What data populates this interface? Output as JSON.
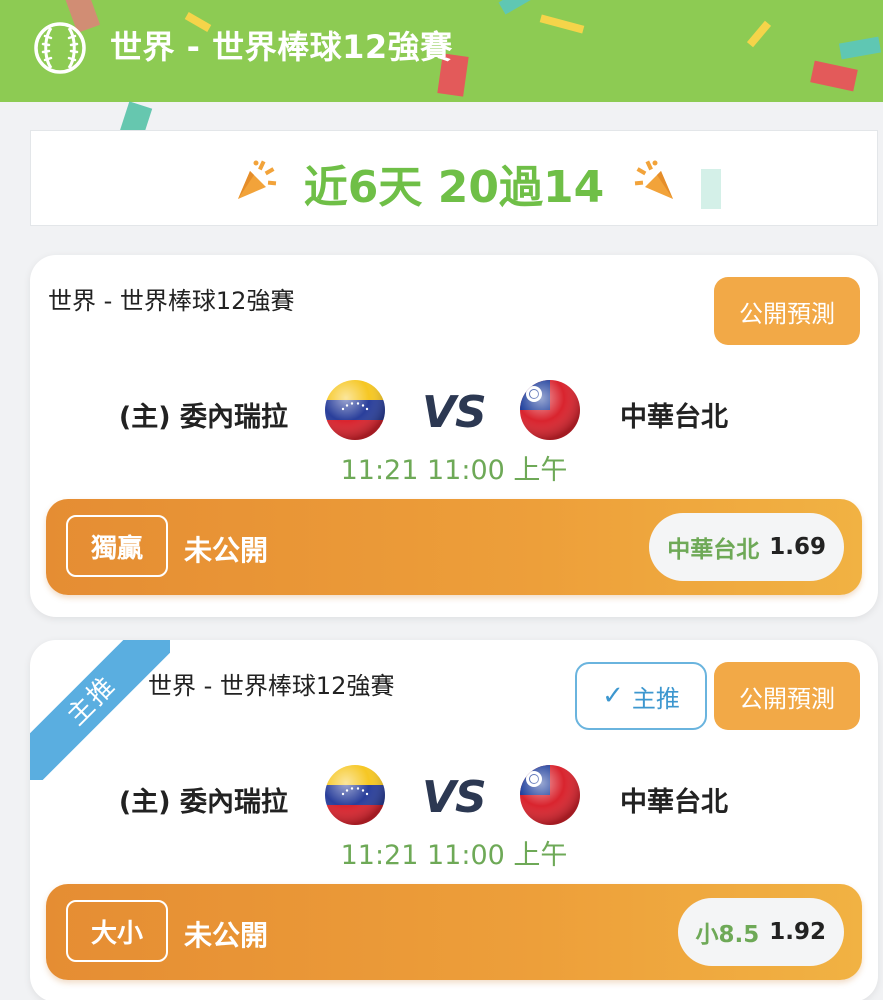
{
  "header": {
    "title": "世界 - 世界棒球12強賽",
    "icon": "baseball-icon",
    "bg_color": "#8dcb53"
  },
  "banner": {
    "stats": "近6天 20過14",
    "icons": [
      "party-popper-icon",
      "party-popper-icon"
    ],
    "text_color": "#6fbf47"
  },
  "matches": [
    {
      "league": "世界 - 世界棒球12強賽",
      "public_label": "公開預測",
      "home_team": "(主) 委內瑞拉",
      "home_flag": "venezuela-flag-icon",
      "vs": "VS",
      "away_team": "中華台北",
      "away_flag": "taiwan-flag-icon",
      "time": "11:21 11:00 上午",
      "bet_type": "獨贏",
      "bet_status": "未公開",
      "pick": "中華台北",
      "odds": "1.69"
    },
    {
      "ribbon": "主推",
      "league": "世界 - 世界棒球12強賽",
      "main_label": "主推",
      "public_label": "公開預測",
      "home_team": "(主) 委內瑞拉",
      "home_flag": "venezuela-flag-icon",
      "vs": "VS",
      "away_team": "中華台北",
      "away_flag": "taiwan-flag-icon",
      "time": "11:21 11:00 上午",
      "bet_type": "大小",
      "bet_status": "未公開",
      "pick": "小8.5",
      "odds": "1.92"
    }
  ],
  "colors": {
    "accent_orange": "#f2a947",
    "main_blue": "#5aaee0",
    "time_green": "#6ea957"
  }
}
